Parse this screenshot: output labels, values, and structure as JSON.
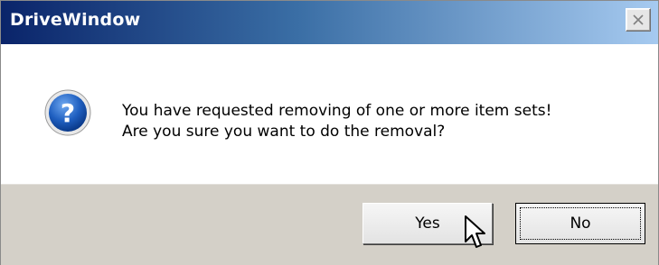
{
  "window": {
    "title": "DriveWindow"
  },
  "dialog": {
    "message_line1": "You have requested removing of one or more item sets!",
    "message_line2": "Are you sure you want to do the removal?",
    "icon": "question-icon"
  },
  "buttons": {
    "yes_label": "Yes",
    "no_label": "No"
  },
  "colors": {
    "titlebar_start": "#0a246a",
    "titlebar_end": "#a6caf0",
    "button_bar": "#d4d0c8"
  },
  "icons": [
    "close-icon",
    "question-icon",
    "mouse-cursor-icon"
  ]
}
